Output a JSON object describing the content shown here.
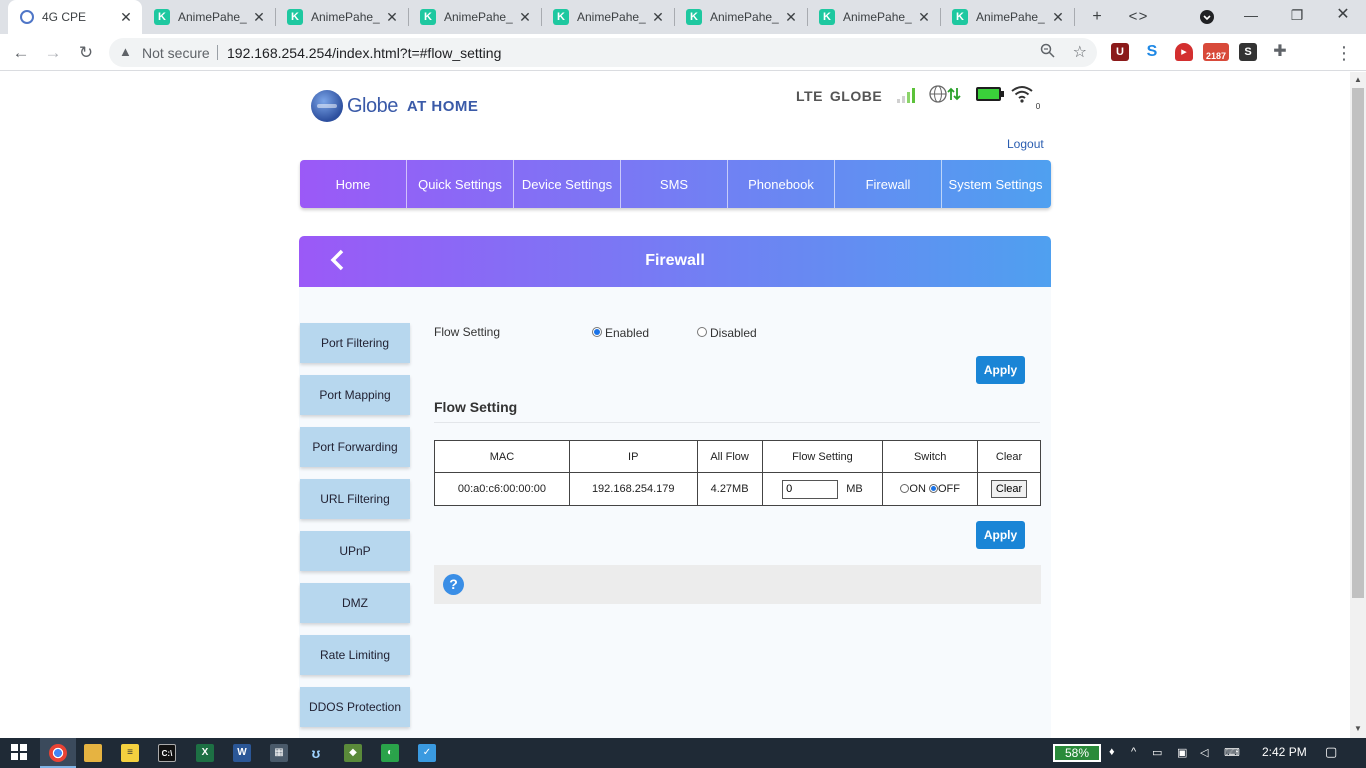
{
  "browser": {
    "tabs": [
      {
        "title": "4G CPE",
        "active": true
      },
      {
        "title": "AnimePahe_",
        "active": false
      },
      {
        "title": "AnimePahe_",
        "active": false
      },
      {
        "title": "AnimePahe_",
        "active": false
      },
      {
        "title": "AnimePahe_",
        "active": false
      },
      {
        "title": "AnimePahe_",
        "active": false
      },
      {
        "title": "AnimePahe_",
        "active": false
      },
      {
        "title": "AnimePahe_",
        "active": false
      }
    ],
    "security_label": "Not secure",
    "url": "192.168.254.254/index.html?t=#flow_setting",
    "extension_badge": "2187"
  },
  "header": {
    "logo_text": "Globe",
    "logo_sub": "AT HOME",
    "network": "LTE",
    "carrier": "GLOBE",
    "wifi_clients": "0",
    "logout": "Logout"
  },
  "nav": [
    "Home",
    "Quick Settings",
    "Device Settings",
    "SMS",
    "Phonebook",
    "Firewall",
    "System Settings"
  ],
  "panel": {
    "title": "Firewall"
  },
  "sidebar": [
    "Port Filtering",
    "Port Mapping",
    "Port Forwarding",
    "URL Filtering",
    "UPnP",
    "DMZ",
    "Rate Limiting",
    "DDOS Protection"
  ],
  "flow": {
    "label": "Flow Setting",
    "enabled_label": "Enabled",
    "disabled_label": "Disabled",
    "selected": "Enabled",
    "apply_label": "Apply",
    "section_title": "Flow Setting",
    "columns": [
      "MAC",
      "IP",
      "All Flow",
      "Flow Setting",
      "Switch",
      "Clear"
    ],
    "rows": [
      {
        "mac": "00:a0:c6:00:00:00",
        "ip": "192.168.254.179",
        "all_flow": "4.27MB",
        "flow_setting": "0",
        "unit": "MB",
        "on_label": "ON",
        "off_label": "OFF",
        "switch": "OFF",
        "clear_label": "Clear"
      }
    ],
    "apply_label_2": "Apply"
  },
  "taskbar": {
    "battery": "58%",
    "time": "2:42 PM"
  },
  "colors": {
    "nav_gradient_start": "#9b59f7",
    "nav_gradient_end": "#4fa0f0",
    "apply_button": "#1a85d6",
    "sidebar_button": "#b7d7ee"
  }
}
